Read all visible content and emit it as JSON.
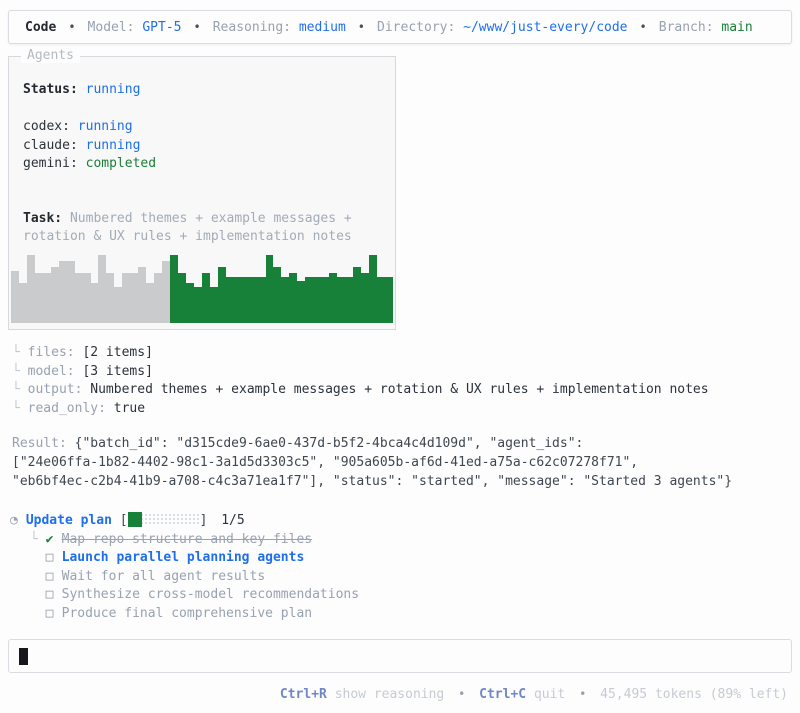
{
  "symbols": {
    "bullet": "•",
    "tree_corner": "└",
    "checkbox": "□",
    "check": "✔",
    "plan_icon": "◔",
    "bracket_open": "[",
    "bracket_close": "]",
    "cursor": "▌"
  },
  "colors": {
    "accent_blue": "#1f6feb",
    "accent_green": "#1a7f37",
    "bar_gray": "#c9cbcd",
    "bar_green": "#17813a"
  },
  "header": {
    "app": "Code",
    "model_label": "Model:",
    "model_value": "GPT-5",
    "reasoning_label": "Reasoning:",
    "reasoning_value": "medium",
    "directory_label": "Directory:",
    "directory_value": "~/www/just-every/code",
    "branch_label": "Branch:",
    "branch_value": "main"
  },
  "agents_panel": {
    "title": "Agents",
    "status_label": "Status:",
    "status_value": "running",
    "agents": [
      {
        "name": "codex:",
        "state": "running"
      },
      {
        "name": "claude:",
        "state": "running"
      },
      {
        "name": "gemini:",
        "state": "completed"
      }
    ],
    "task_label": "Task:",
    "task_value": "Numbered themes + example messages + rotation & UX rules + implementation notes"
  },
  "chart_data": {
    "type": "bar",
    "title": "agent activity sparkline",
    "ylim": [
      0,
      72
    ],
    "bars": [
      {
        "series": "completed",
        "value": 52
      },
      {
        "series": "completed",
        "value": 40
      },
      {
        "series": "completed",
        "value": 68
      },
      {
        "series": "completed",
        "value": 50
      },
      {
        "series": "completed",
        "value": 50
      },
      {
        "series": "completed",
        "value": 56
      },
      {
        "series": "completed",
        "value": 62
      },
      {
        "series": "completed",
        "value": 62
      },
      {
        "series": "completed",
        "value": 50
      },
      {
        "series": "completed",
        "value": 50
      },
      {
        "series": "completed",
        "value": 40
      },
      {
        "series": "completed",
        "value": 68
      },
      {
        "series": "completed",
        "value": 50
      },
      {
        "series": "completed",
        "value": 36
      },
      {
        "series": "completed",
        "value": 50
      },
      {
        "series": "completed",
        "value": 50
      },
      {
        "series": "completed",
        "value": 56
      },
      {
        "series": "completed",
        "value": 40
      },
      {
        "series": "completed",
        "value": 50
      },
      {
        "series": "completed",
        "value": 62
      },
      {
        "series": "running",
        "value": 68
      },
      {
        "series": "running",
        "value": 50
      },
      {
        "series": "running",
        "value": 40
      },
      {
        "series": "running",
        "value": 36
      },
      {
        "series": "running",
        "value": 50
      },
      {
        "series": "running",
        "value": 36
      },
      {
        "series": "running",
        "value": 56
      },
      {
        "series": "running",
        "value": 46
      },
      {
        "series": "running",
        "value": 46
      },
      {
        "series": "running",
        "value": 46
      },
      {
        "series": "running",
        "value": 46
      },
      {
        "series": "running",
        "value": 46
      },
      {
        "series": "running",
        "value": 68
      },
      {
        "series": "running",
        "value": 56
      },
      {
        "series": "running",
        "value": 46
      },
      {
        "series": "running",
        "value": 50
      },
      {
        "series": "running",
        "value": 42
      },
      {
        "series": "running",
        "value": 46
      },
      {
        "series": "running",
        "value": 46
      },
      {
        "series": "running",
        "value": 46
      },
      {
        "series": "running",
        "value": 50
      },
      {
        "series": "running",
        "value": 46
      },
      {
        "series": "running",
        "value": 46
      },
      {
        "series": "running",
        "value": 56
      },
      {
        "series": "running",
        "value": 50
      },
      {
        "series": "running",
        "value": 68
      },
      {
        "series": "running",
        "value": 46
      },
      {
        "series": "running",
        "value": 46
      }
    ]
  },
  "tree": [
    {
      "key": "files:",
      "value": "[2 items]"
    },
    {
      "key": "model:",
      "value": "[3 items]"
    },
    {
      "key": "output:",
      "value": "Numbered themes + example messages + rotation & UX rules + implementation notes"
    },
    {
      "key": "read_only:",
      "value": "true"
    }
  ],
  "result": {
    "label": "Result:",
    "lines": [
      "{\"batch_id\": \"d315cde9-6ae0-437d-b5f2-4bca4c4d109d\", \"agent_ids\":",
      "[\"24e06ffa-1b82-4402-98c1-3a1d5d3303c5\", \"905a605b-af6d-41ed-a75a-c62c07278f71\",",
      "\"eb6bf4ec-c2b4-41b9-a708-c4c3a71ea1f7\"], \"status\": \"started\", \"message\": \"Started 3 agents\"}"
    ]
  },
  "plan": {
    "title": "Update plan",
    "progress_current": 1,
    "progress_total": 5,
    "progress_text": "1/5",
    "items": [
      {
        "marker": "✔",
        "label": "Map repo structure and key files",
        "state": "done"
      },
      {
        "marker": "□",
        "label": "Launch parallel planning agents",
        "state": "active"
      },
      {
        "marker": "□",
        "label": "Wait for all agent results",
        "state": "pending"
      },
      {
        "marker": "□",
        "label": "Synthesize cross-model recommendations",
        "state": "pending"
      },
      {
        "marker": "□",
        "label": "Produce final comprehensive plan",
        "state": "pending"
      }
    ]
  },
  "composer": {
    "value": ""
  },
  "footer": {
    "shortcut1_key": "Ctrl+R",
    "shortcut1_label": "show reasoning",
    "shortcut2_key": "Ctrl+C",
    "shortcut2_label": "quit",
    "tokens_label": "45,495 tokens (89% left)"
  }
}
